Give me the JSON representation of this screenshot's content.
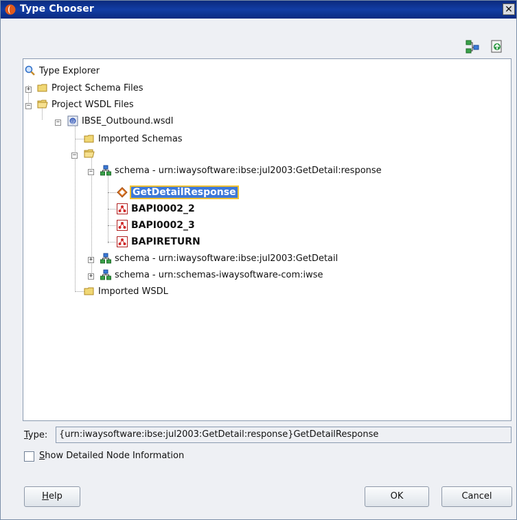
{
  "window": {
    "title": "Type Chooser",
    "close_glyph": "✕",
    "title_icon": "oracle-logo-icon"
  },
  "toolbar": {
    "icons": [
      "hierarchy-icon",
      "import-schema-icon"
    ]
  },
  "tree": {
    "root": "Type Explorer",
    "project_schema_files": "Project Schema Files",
    "project_wsdl_files": "Project WSDL Files",
    "wsdl_file": "IBSE_Outbound.wsdl",
    "imported_schemas": "Imported Schemas",
    "schema_response": "schema - urn:iwaysoftware:ibse:jul2003:GetDetail:response",
    "selected_element": "GetDetailResponse",
    "element_2": "BAPI0002_2",
    "element_3": "BAPI0002_3",
    "element_4": "BAPIRETURN",
    "schema_getdetail": "schema - urn:iwaysoftware:ibse:jul2003:GetDetail",
    "schema_iwse": "schema - urn:schemas-iwaysoftware-com:iwse",
    "imported_wsdl": "Imported WSDL"
  },
  "type_field": {
    "label_mnemonic": "T",
    "label_rest": "ype:",
    "value": "{urn:iwaysoftware:ibse:jul2003:GetDetail:response}GetDetailResponse"
  },
  "show_detailed": {
    "mnemonic": "S",
    "rest": "how Detailed Node Information",
    "checked": false
  },
  "buttons": {
    "help_mnemonic": "H",
    "help_rest": "elp",
    "ok": "OK",
    "cancel": "Cancel"
  },
  "colors": {
    "title_bar": "#123da4",
    "selection": "#3d78d8",
    "selection_outline": "#f2c230"
  }
}
